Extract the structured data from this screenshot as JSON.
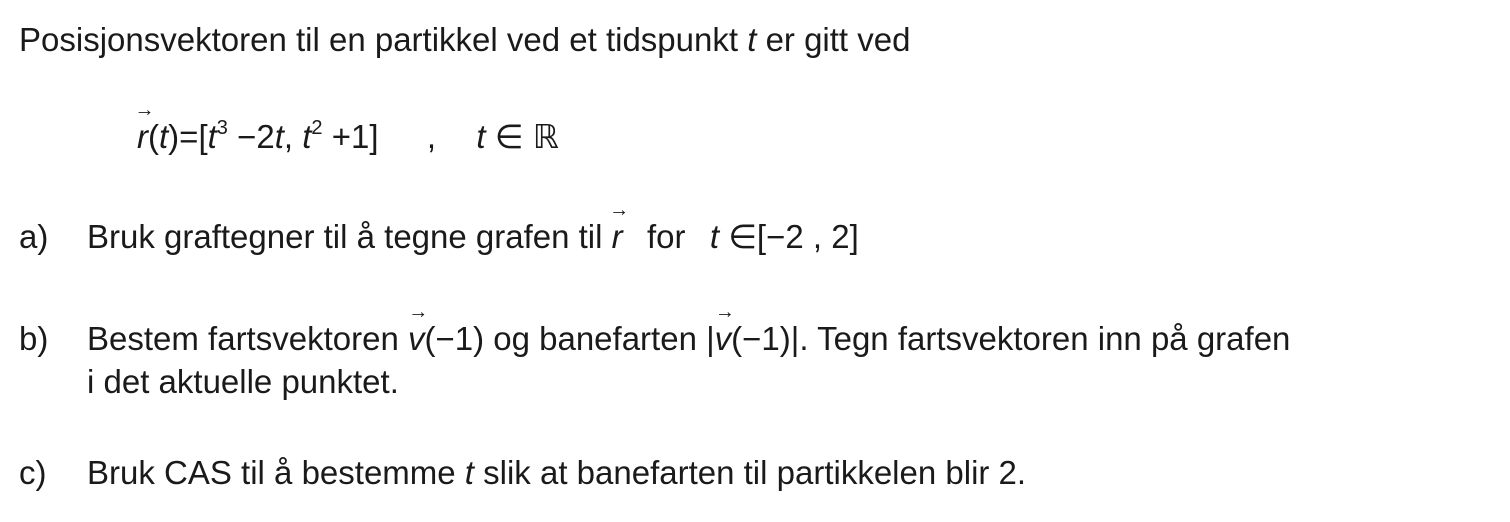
{
  "intro": {
    "text": "Posisjonsvektoren til en partikkel ved et tidspunkt",
    "var_t": "t",
    "end": "er gitt ved"
  },
  "formula": {
    "r": "r",
    "paren_t_open": "(",
    "t": "t",
    "paren_t_close": ")",
    "eq": "=[",
    "t1": "t",
    "exp3": "3",
    "minus2t": "−2",
    "t2": "t",
    "comma": ",",
    "t3": "t",
    "exp2": "2",
    "plus1": "+1]",
    "sep": ",",
    "t4": "t",
    "in": "∈",
    "R": "ℝ"
  },
  "part_a": {
    "label": "a)",
    "text1": "Bruk graftegner til å tegne grafen til",
    "r": "r",
    "text2": "for",
    "t": "t",
    "range": "∈[−2 , 2]"
  },
  "part_b": {
    "label": "b)",
    "text1": "Bestem fartsvektoren",
    "v1": "v",
    "arg1": "(−1)",
    "text2": "og banefarten |",
    "v2": "v",
    "arg2": "(−1)|",
    "text3": ". Tegn fartsvektoren inn på grafen",
    "line2": "i det aktuelle punktet."
  },
  "part_c": {
    "label": "c)",
    "text1": "Bruk CAS til å bestemme",
    "t": "t",
    "text2": "slik at banefarten til partikkelen blir 2."
  }
}
